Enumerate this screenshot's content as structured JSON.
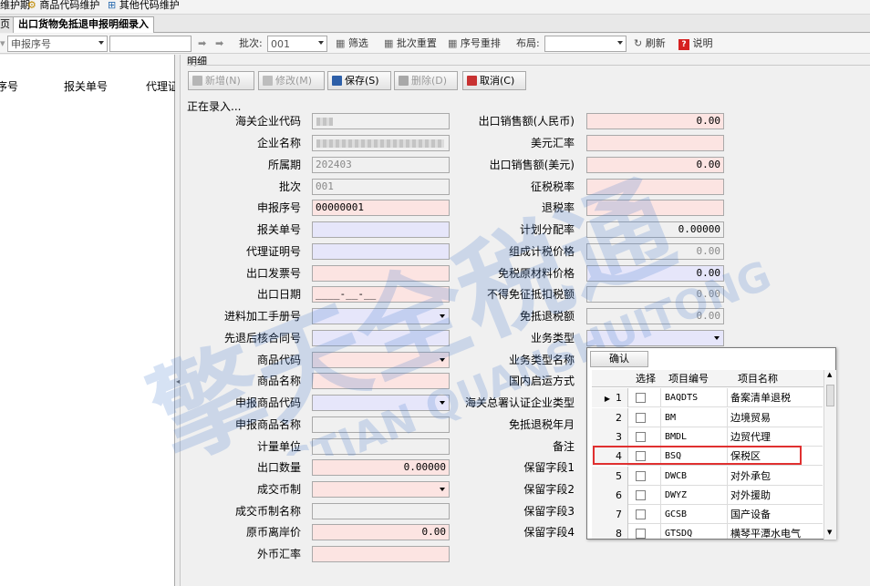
{
  "menu": {
    "items": [
      "维护期",
      "商品代码维护",
      "其他代码维护"
    ]
  },
  "tabs": [
    {
      "label": "页",
      "active": false
    },
    {
      "label": "出口货物免抵退申报明细录入",
      "active": true
    }
  ],
  "toolbar": {
    "filter_placeholder": "申报序号",
    "batch_label": "批次:",
    "batch_value": "001",
    "filter_btn": "筛选",
    "batch_reset": "批次重置",
    "seq_reorder": "序号重排",
    "layout_label": "布局:",
    "refresh": "刷新",
    "help": "说明"
  },
  "left_panel": {
    "columns": [
      "序号",
      "报关单号",
      "代理证"
    ]
  },
  "detail": {
    "group_title": "明细",
    "buttons": {
      "add": "新增(N)",
      "edit": "修改(M)",
      "save": "保存(S)",
      "delete": "删除(D)",
      "cancel": "取消(C)"
    },
    "status": "正在录入..."
  },
  "form_left": [
    {
      "label": "海关企业代码",
      "value": ""
    },
    {
      "label": "企业名称",
      "value": ""
    },
    {
      "label": "所属期",
      "value": "202403"
    },
    {
      "label": "批次",
      "value": "001"
    },
    {
      "label": "申报序号",
      "value": "00000001"
    },
    {
      "label": "报关单号",
      "value": ""
    },
    {
      "label": "代理证明号",
      "value": ""
    },
    {
      "label": "出口发票号",
      "value": ""
    },
    {
      "label": "出口日期",
      "value": "____-__-__"
    },
    {
      "label": "进料加工手册号",
      "value": ""
    },
    {
      "label": "先退后核合同号",
      "value": ""
    },
    {
      "label": "商品代码",
      "value": ""
    },
    {
      "label": "商品名称",
      "value": ""
    },
    {
      "label": "申报商品代码",
      "value": ""
    },
    {
      "label": "申报商品名称",
      "value": ""
    },
    {
      "label": "计量单位",
      "value": ""
    },
    {
      "label": "出口数量",
      "value": "0.00000"
    },
    {
      "label": "成交币制",
      "value": ""
    },
    {
      "label": "成交币制名称",
      "value": ""
    },
    {
      "label": "原币离岸价",
      "value": "0.00"
    },
    {
      "label": "外币汇率",
      "value": ""
    }
  ],
  "form_right": [
    {
      "label": "出口销售额(人民币)",
      "value": "0.00"
    },
    {
      "label": "美元汇率",
      "value": ""
    },
    {
      "label": "出口销售额(美元)",
      "value": "0.00"
    },
    {
      "label": "征税税率",
      "value": ""
    },
    {
      "label": "退税率",
      "value": ""
    },
    {
      "label": "计划分配率",
      "value": "0.00000"
    },
    {
      "label": "组成计税价格",
      "value": "0.00"
    },
    {
      "label": "免税原材料价格",
      "value": "0.00"
    },
    {
      "label": "不得免征抵扣税额",
      "value": "0.00"
    },
    {
      "label": "免抵退税额",
      "value": "0.00"
    },
    {
      "label": "业务类型",
      "value": ""
    },
    {
      "label": "业务类型名称",
      "value": ""
    },
    {
      "label": "国内启运方式",
      "value": ""
    },
    {
      "label": "海关总署认证企业类型",
      "value": ""
    },
    {
      "label": "免抵退税年月",
      "value": ""
    },
    {
      "label": "备注",
      "value": ""
    },
    {
      "label": "保留字段1",
      "value": ""
    },
    {
      "label": "保留字段2",
      "value": ""
    },
    {
      "label": "保留字段3",
      "value": ""
    },
    {
      "label": "保留字段4",
      "value": ""
    }
  ],
  "popup": {
    "confirm": "确认",
    "headers": [
      "选择",
      "项目编号",
      "项目名称"
    ],
    "rows": [
      {
        "n": "1",
        "code": "BAQDTS",
        "name": "备案清单退税"
      },
      {
        "n": "2",
        "code": "BM",
        "name": "边境贸易"
      },
      {
        "n": "3",
        "code": "BMDL",
        "name": "边贸代理"
      },
      {
        "n": "4",
        "code": "BSQ",
        "name": "保税区"
      },
      {
        "n": "5",
        "code": "DWCB",
        "name": "对外承包"
      },
      {
        "n": "6",
        "code": "DWYZ",
        "name": "对外援助"
      },
      {
        "n": "7",
        "code": "GCSB",
        "name": "国产设备"
      },
      {
        "n": "8",
        "code": "GTSDQ",
        "name": "横琴平潭水电气"
      }
    ]
  },
  "watermark": {
    "cn": "擎天全税通",
    "en": "QINGTIAN QUANSHUITONG"
  }
}
